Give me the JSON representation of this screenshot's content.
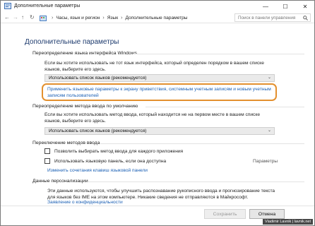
{
  "window": {
    "title": "Дополнительные параметры",
    "minimize_symbol": "—",
    "maximize_symbol": "☐",
    "close_symbol": "✕"
  },
  "address_bar": {
    "back_symbol": "←",
    "forward_symbol": "→",
    "up_symbol": "↑",
    "refresh_symbol": "↻",
    "crumb_separator": "›",
    "breadcrumbs": [
      "Часы, язык и регион",
      "Язык",
      "Дополнительные параметры"
    ],
    "search_placeholder": "Поиск в панели управления"
  },
  "main": {
    "heading": "Дополнительные параметры",
    "ui_language": {
      "title": "Переопределение языка интерфейса Windows",
      "description": "Если вы хотите использовать не тот язык интерфейса, который определен порядком в вашем списке языков, выберите его здесь.",
      "dropdown_value": "Использовать список языков (рекомендуется)",
      "apply_link": "Применить языковые параметры к экрану приветствия, системным учетным записям и новым учетным записям пользователей"
    },
    "input_method": {
      "title": "Переопределение метода ввода по умолчанию",
      "description": "Если вы хотите использовать метод ввода, который находится не на первом месте в вашем списке языков, выберите его здесь.",
      "dropdown_value": "Использовать список языков (рекомендуется)"
    },
    "switching": {
      "title": "Переключение методов ввода",
      "checkbox_per_app": "Позволить выбирать метод ввода для каждого приложения",
      "checkbox_language_bar": "Использовать языковую панель, если она доступна",
      "params_label": "Параметры",
      "hotkeys_link": "Изменить сочетания клавиш языковой панели"
    },
    "personalization": {
      "title": "Данные персонализации",
      "description": "Эти данные используются, чтобы улучшить распознавание рукописного ввода и прогнозирование текста для языков без IME на этом компьютере. Никакие сведения не отправляются в Майкрософт.",
      "privacy_link": "Заявление о конфиденциальности"
    }
  },
  "footer": {
    "save_label": "Сохранить",
    "cancel_label": "Отмена"
  },
  "watermark": "Vladimir Lavnik | lavnik.net",
  "colors": {
    "accent_highlight": "#e3902e",
    "link": "#1a5fb4",
    "heading": "#1e3b6e"
  },
  "icons": {
    "title_icon": "language-settings-icon",
    "control_panel": "control-panel-icon",
    "search": "search-icon"
  }
}
